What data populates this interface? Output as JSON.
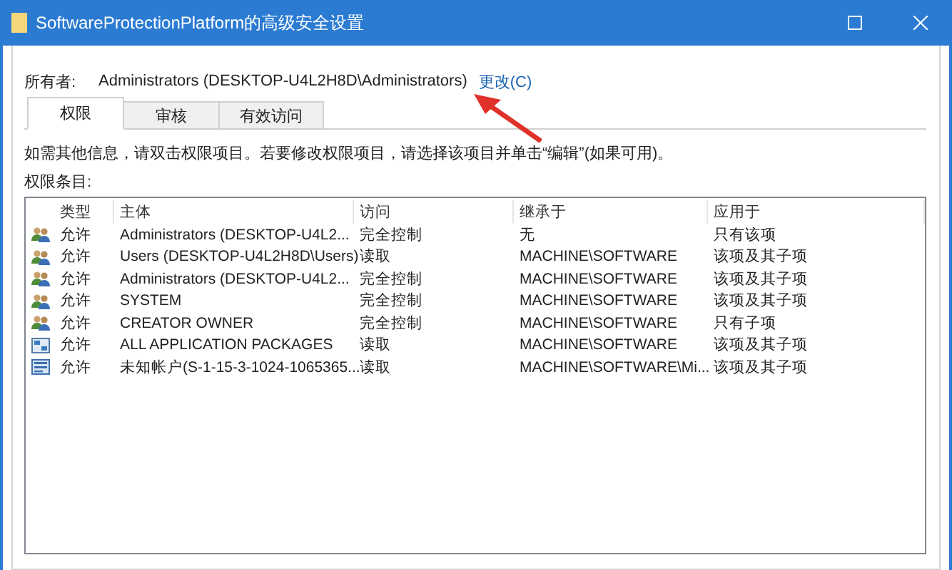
{
  "window": {
    "title": "SoftwareProtectionPlatform的高级安全设置"
  },
  "owner": {
    "label": "所有者:",
    "value": "Administrators (DESKTOP-U4L2H8D\\Administrators)",
    "link": "更改(C)"
  },
  "tabs": [
    {
      "label": "权限",
      "selected": true
    },
    {
      "label": "审核",
      "selected": false
    },
    {
      "label": "有效访问",
      "selected": false
    }
  ],
  "info": "如需其他信息，请双击权限项目。若要修改权限项目，请选择该项目并单击“编辑”(如果可用)。",
  "list_label": "权限条目:",
  "table": {
    "columns": [
      "类型",
      "主体",
      "访问",
      "继承于",
      "应用于"
    ],
    "rows": [
      {
        "kind": "group",
        "cells": [
          "允许",
          "Administrators (DESKTOP-U4L2...",
          "完全控制",
          "无",
          "只有该项"
        ]
      },
      {
        "kind": "group",
        "cells": [
          "允许",
          "Users (DESKTOP-U4L2H8D\\Users)",
          "读取",
          "MACHINE\\SOFTWARE",
          "该项及其子项"
        ]
      },
      {
        "kind": "group",
        "cells": [
          "允许",
          "Administrators (DESKTOP-U4L2...",
          "完全控制",
          "MACHINE\\SOFTWARE",
          "该项及其子项"
        ]
      },
      {
        "kind": "group",
        "cells": [
          "允许",
          "SYSTEM",
          "完全控制",
          "MACHINE\\SOFTWARE",
          "该项及其子项"
        ]
      },
      {
        "kind": "group",
        "cells": [
          "允许",
          "CREATOR OWNER",
          "完全控制",
          "MACHINE\\SOFTWARE",
          "只有子项"
        ]
      },
      {
        "kind": "package",
        "cells": [
          "允许",
          "ALL APPLICATION PACKAGES",
          "读取",
          "MACHINE\\SOFTWARE",
          "该项及其子项"
        ]
      },
      {
        "kind": "unknown",
        "cells": [
          "允许",
          "未知帐户(S-1-15-3-1024-1065365...",
          "读取",
          "MACHINE\\SOFTWARE\\Mi...",
          "该项及其子项"
        ]
      }
    ]
  }
}
